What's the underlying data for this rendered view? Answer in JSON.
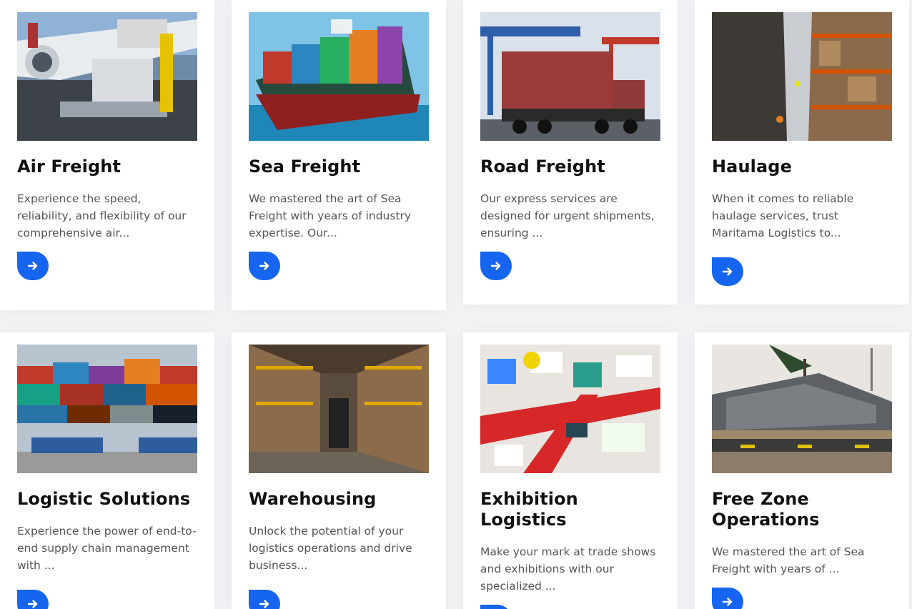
{
  "services": [
    {
      "title": "Air Freight",
      "desc": "Experience the speed, reliability, and flexibility of our comprehensive air...",
      "image_icon": "air-freight-photo"
    },
    {
      "title": "Sea Freight",
      "desc": "We mastered the art of Sea Freight with years of industry expertise. Our...",
      "image_icon": "sea-freight-photo"
    },
    {
      "title": "Road Freight",
      "desc": "Our express services are designed for urgent shipments, ensuring ...",
      "image_icon": "road-freight-photo"
    },
    {
      "title": "Haulage",
      "desc": "When it comes to reliable haulage services, trust Maritama Logistics to...",
      "image_icon": "haulage-photo"
    },
    {
      "title": "Logistic Solutions",
      "desc": "Experience the power of end-to-end supply chain management with ...",
      "image_icon": "logistic-solutions-photo"
    },
    {
      "title": "Warehousing",
      "desc": "Unlock the potential of your logistics operations and drive business...",
      "image_icon": "warehousing-photo"
    },
    {
      "title": "Exhibition Logistics",
      "desc": "Make your mark at trade shows and exhibitions with our specialized ...",
      "image_icon": "exhibition-logistics-photo"
    },
    {
      "title": "Free Zone Operations",
      "desc": "We mastered the art of Sea Freight with years of ...",
      "image_icon": "free-zone-photo"
    }
  ],
  "colors": {
    "accent": "#1565f0",
    "title": "#111111",
    "text": "#555555",
    "card": "#ffffff",
    "background": "#f3f3f5"
  }
}
